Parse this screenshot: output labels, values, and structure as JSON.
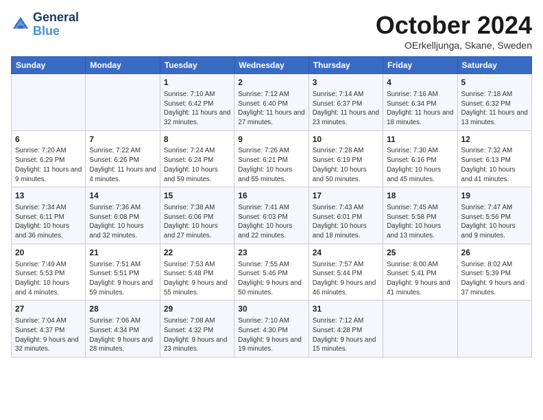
{
  "logo": {
    "line1": "General",
    "line2": "Blue"
  },
  "title": "October 2024",
  "subtitle": "OErkelljunga, Skane, Sweden",
  "days_of_week": [
    "Sunday",
    "Monday",
    "Tuesday",
    "Wednesday",
    "Thursday",
    "Friday",
    "Saturday"
  ],
  "weeks": [
    [
      {
        "day": "",
        "info": ""
      },
      {
        "day": "",
        "info": ""
      },
      {
        "day": "1",
        "sunrise": "Sunrise: 7:10 AM",
        "sunset": "Sunset: 6:42 PM",
        "daylight": "Daylight: 11 hours and 32 minutes."
      },
      {
        "day": "2",
        "sunrise": "Sunrise: 7:12 AM",
        "sunset": "Sunset: 6:40 PM",
        "daylight": "Daylight: 11 hours and 27 minutes."
      },
      {
        "day": "3",
        "sunrise": "Sunrise: 7:14 AM",
        "sunset": "Sunset: 6:37 PM",
        "daylight": "Daylight: 11 hours and 23 minutes."
      },
      {
        "day": "4",
        "sunrise": "Sunrise: 7:16 AM",
        "sunset": "Sunset: 6:34 PM",
        "daylight": "Daylight: 11 hours and 18 minutes."
      },
      {
        "day": "5",
        "sunrise": "Sunrise: 7:18 AM",
        "sunset": "Sunset: 6:32 PM",
        "daylight": "Daylight: 11 hours and 13 minutes."
      }
    ],
    [
      {
        "day": "6",
        "sunrise": "Sunrise: 7:20 AM",
        "sunset": "Sunset: 6:29 PM",
        "daylight": "Daylight: 11 hours and 9 minutes."
      },
      {
        "day": "7",
        "sunrise": "Sunrise: 7:22 AM",
        "sunset": "Sunset: 6:26 PM",
        "daylight": "Daylight: 11 hours and 4 minutes."
      },
      {
        "day": "8",
        "sunrise": "Sunrise: 7:24 AM",
        "sunset": "Sunset: 6:24 PM",
        "daylight": "Daylight: 10 hours and 59 minutes."
      },
      {
        "day": "9",
        "sunrise": "Sunrise: 7:26 AM",
        "sunset": "Sunset: 6:21 PM",
        "daylight": "Daylight: 10 hours and 55 minutes."
      },
      {
        "day": "10",
        "sunrise": "Sunrise: 7:28 AM",
        "sunset": "Sunset: 6:19 PM",
        "daylight": "Daylight: 10 hours and 50 minutes."
      },
      {
        "day": "11",
        "sunrise": "Sunrise: 7:30 AM",
        "sunset": "Sunset: 6:16 PM",
        "daylight": "Daylight: 10 hours and 45 minutes."
      },
      {
        "day": "12",
        "sunrise": "Sunrise: 7:32 AM",
        "sunset": "Sunset: 6:13 PM",
        "daylight": "Daylight: 10 hours and 41 minutes."
      }
    ],
    [
      {
        "day": "13",
        "sunrise": "Sunrise: 7:34 AM",
        "sunset": "Sunset: 6:11 PM",
        "daylight": "Daylight: 10 hours and 36 minutes."
      },
      {
        "day": "14",
        "sunrise": "Sunrise: 7:36 AM",
        "sunset": "Sunset: 6:08 PM",
        "daylight": "Daylight: 10 hours and 32 minutes."
      },
      {
        "day": "15",
        "sunrise": "Sunrise: 7:38 AM",
        "sunset": "Sunset: 6:06 PM",
        "daylight": "Daylight: 10 hours and 27 minutes."
      },
      {
        "day": "16",
        "sunrise": "Sunrise: 7:41 AM",
        "sunset": "Sunset: 6:03 PM",
        "daylight": "Daylight: 10 hours and 22 minutes."
      },
      {
        "day": "17",
        "sunrise": "Sunrise: 7:43 AM",
        "sunset": "Sunset: 6:01 PM",
        "daylight": "Daylight: 10 hours and 18 minutes."
      },
      {
        "day": "18",
        "sunrise": "Sunrise: 7:45 AM",
        "sunset": "Sunset: 5:58 PM",
        "daylight": "Daylight: 10 hours and 13 minutes."
      },
      {
        "day": "19",
        "sunrise": "Sunrise: 7:47 AM",
        "sunset": "Sunset: 5:56 PM",
        "daylight": "Daylight: 10 hours and 9 minutes."
      }
    ],
    [
      {
        "day": "20",
        "sunrise": "Sunrise: 7:49 AM",
        "sunset": "Sunset: 5:53 PM",
        "daylight": "Daylight: 10 hours and 4 minutes."
      },
      {
        "day": "21",
        "sunrise": "Sunrise: 7:51 AM",
        "sunset": "Sunset: 5:51 PM",
        "daylight": "Daylight: 9 hours and 59 minutes."
      },
      {
        "day": "22",
        "sunrise": "Sunrise: 7:53 AM",
        "sunset": "Sunset: 5:48 PM",
        "daylight": "Daylight: 9 hours and 55 minutes."
      },
      {
        "day": "23",
        "sunrise": "Sunrise: 7:55 AM",
        "sunset": "Sunset: 5:46 PM",
        "daylight": "Daylight: 9 hours and 50 minutes."
      },
      {
        "day": "24",
        "sunrise": "Sunrise: 7:57 AM",
        "sunset": "Sunset: 5:44 PM",
        "daylight": "Daylight: 9 hours and 46 minutes."
      },
      {
        "day": "25",
        "sunrise": "Sunrise: 8:00 AM",
        "sunset": "Sunset: 5:41 PM",
        "daylight": "Daylight: 9 hours and 41 minutes."
      },
      {
        "day": "26",
        "sunrise": "Sunrise: 8:02 AM",
        "sunset": "Sunset: 5:39 PM",
        "daylight": "Daylight: 9 hours and 37 minutes."
      }
    ],
    [
      {
        "day": "27",
        "sunrise": "Sunrise: 7:04 AM",
        "sunset": "Sunset: 4:37 PM",
        "daylight": "Daylight: 9 hours and 32 minutes."
      },
      {
        "day": "28",
        "sunrise": "Sunrise: 7:06 AM",
        "sunset": "Sunset: 4:34 PM",
        "daylight": "Daylight: 9 hours and 28 minutes."
      },
      {
        "day": "29",
        "sunrise": "Sunrise: 7:08 AM",
        "sunset": "Sunset: 4:32 PM",
        "daylight": "Daylight: 9 hours and 23 minutes."
      },
      {
        "day": "30",
        "sunrise": "Sunrise: 7:10 AM",
        "sunset": "Sunset: 4:30 PM",
        "daylight": "Daylight: 9 hours and 19 minutes."
      },
      {
        "day": "31",
        "sunrise": "Sunrise: 7:12 AM",
        "sunset": "Sunset: 4:28 PM",
        "daylight": "Daylight: 9 hours and 15 minutes."
      },
      {
        "day": "",
        "info": ""
      },
      {
        "day": "",
        "info": ""
      }
    ]
  ]
}
